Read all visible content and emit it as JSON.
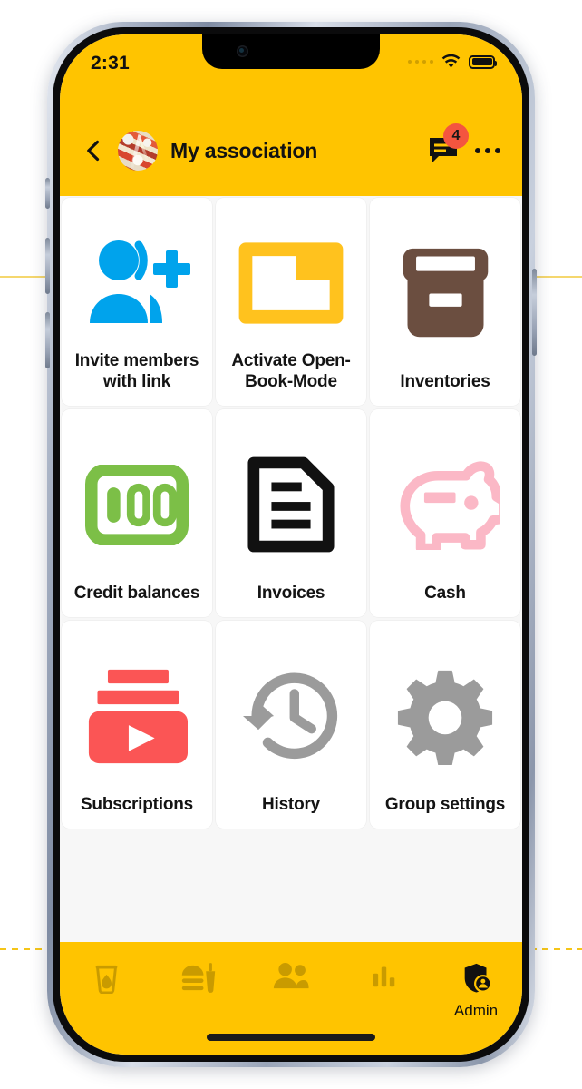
{
  "colors": {
    "brand_yellow": "#FFC400",
    "badge_red": "#F4553F",
    "nav_inactive": "#C99B00",
    "nav_active": "#111111",
    "tile_bg": "#FFFFFF",
    "screen_bg": "#F7F7F7",
    "icon_blue": "#00A3EC",
    "icon_folder_yellow": "#FFC21E",
    "icon_brown": "#6B4E40",
    "icon_green": "#7CBF47",
    "icon_black": "#111111",
    "icon_pink": "#FBB8C6",
    "icon_red": "#FB5555",
    "icon_gray": "#9B9B9B"
  },
  "status_bar": {
    "time": "2:31",
    "signal_icon": "signal-dots-icon",
    "wifi_icon": "wifi-icon",
    "battery_icon": "battery-full-icon"
  },
  "app_bar": {
    "back_icon": "back-chevron-icon",
    "avatar_icon": "group-avatar-photo",
    "title": "My association",
    "chat_icon": "chat-bubble-icon",
    "chat_badge_count": "4",
    "overflow_icon": "more-options-icon"
  },
  "grid": {
    "tiles": [
      {
        "label": "Invite members with link",
        "icon": "person-add-icon",
        "icon_color": "#00A3EC"
      },
      {
        "label": "Activate Open-Book-Mode",
        "icon": "open-folder-icon",
        "icon_color": "#FFC21E"
      },
      {
        "label": "Inventories",
        "icon": "archive-box-icon",
        "icon_color": "#6B4E40"
      },
      {
        "label": "Credit balances",
        "icon": "hundred-banknote-icon",
        "icon_color": "#7CBF47"
      },
      {
        "label": "Invoices",
        "icon": "document-lines-icon",
        "icon_color": "#111111"
      },
      {
        "label": "Cash",
        "icon": "piggy-bank-icon",
        "icon_color": "#FBB8C6"
      },
      {
        "label": "Subscriptions",
        "icon": "play-subscription-icon",
        "icon_color": "#FB5555"
      },
      {
        "label": "History",
        "icon": "clock-rewind-icon",
        "icon_color": "#9B9B9B"
      },
      {
        "label": "Group settings",
        "icon": "gear-icon",
        "icon_color": "#9B9B9B"
      }
    ]
  },
  "bottom_nav": {
    "items": [
      {
        "label": "",
        "icon": "drink-glass-icon",
        "active": false
      },
      {
        "label": "",
        "icon": "food-meal-icon",
        "active": false
      },
      {
        "label": "",
        "icon": "people-icon",
        "active": false
      },
      {
        "label": "",
        "icon": "bar-chart-icon",
        "active": false
      },
      {
        "label": "Admin",
        "icon": "shield-admin-icon",
        "active": true
      }
    ]
  }
}
